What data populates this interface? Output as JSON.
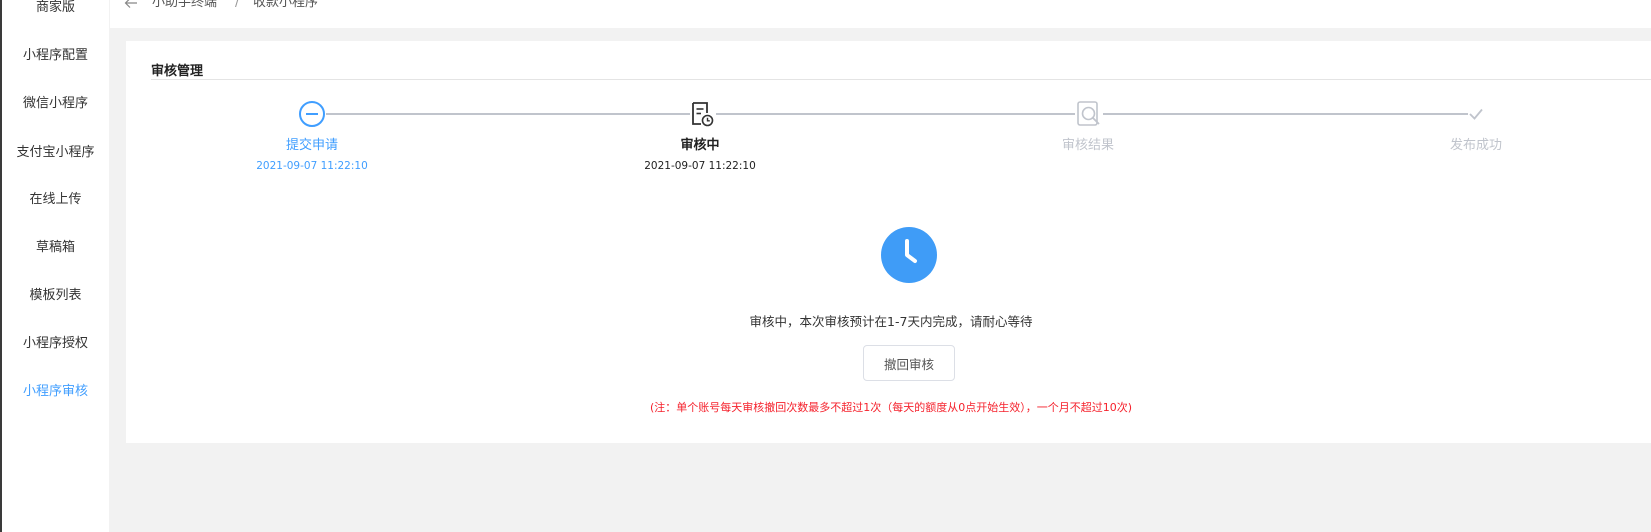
{
  "sidebar": {
    "items": [
      {
        "label": "商家版"
      },
      {
        "label": "小程序配置"
      },
      {
        "label": "微信小程序"
      },
      {
        "label": "支付宝小程序"
      },
      {
        "label": "在线上传"
      },
      {
        "label": "草稿箱"
      },
      {
        "label": "模板列表"
      },
      {
        "label": "小程序授权"
      },
      {
        "label": "小程序审核"
      }
    ],
    "active_index": 8
  },
  "breadcrumb": {
    "items": [
      "小助手终端",
      "收款小程序"
    ],
    "separator": "/"
  },
  "section": {
    "title": "审核管理"
  },
  "steps": [
    {
      "label": "提交申请",
      "time": "2021-09-07 11:22:10",
      "status": "done"
    },
    {
      "label": "审核中",
      "time": "2021-09-07 11:22:10",
      "status": "current"
    },
    {
      "label": "审核结果",
      "time": "",
      "status": "wait"
    },
    {
      "label": "发布成功",
      "time": "",
      "status": "wait"
    }
  ],
  "review": {
    "message": "审核中，本次审核预计在1-7天内完成，请耐心等待",
    "withdraw_label": "撤回审核",
    "note": "(注：单个账号每天审核撤回次数最多不超过1次（每天的额度从0点开始生效），一个月不超过10次)"
  },
  "colors": {
    "accent": "#409eff",
    "clock": "#3f9cf7",
    "note": "#f5222d",
    "inactive": "#c0c4cc",
    "background": "#f2f2f2"
  }
}
